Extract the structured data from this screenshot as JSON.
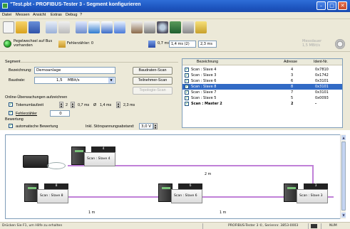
{
  "window": {
    "title": "\"Test.pbt - PROFIBUS-Tester 3 - Segment konfigurieren"
  },
  "menu": [
    "Datei",
    "Messen",
    "Ansicht",
    "Extras",
    "Debug",
    "?"
  ],
  "status": {
    "bus_status_line1": "Pegelwechsel auf Bus",
    "bus_status_line2": "vorhanden",
    "error_counter": "Fehlerzähler: 0",
    "time_1": "0,7 ms",
    "time_2": "1,4 ms (2)",
    "time_3": "2,3 ms",
    "right_info_1": "Messdauer",
    "right_info_2": "1,5 MBit/s"
  },
  "segment": {
    "group_label": "Segment",
    "name_label": "Bezeichnung:",
    "name_value": "Demoanlage",
    "baud_label": "Baudrate:",
    "baud_value": "1,5",
    "baud_unit": "MBit/s",
    "btn_baud_scan": "Baudraten-Scan",
    "btn_participant_scan": "Teilnehmer-Scan",
    "btn_topology_scan": "Topologie-Scan"
  },
  "monitoring": {
    "group_label": "Online-Überwachungen aufzeichnen",
    "token_label": "Tokenumlaufzeit",
    "token_count": "2",
    "token_min": "0,7 ms",
    "token_avg_prefix": "Ø",
    "token_avg": "1,4 ms",
    "token_max": "2,3 ms",
    "error_counter_label": "Fehlerzähler",
    "error_counter_value": "0"
  },
  "evaluation": {
    "group_label": "Bewertung",
    "auto_label": "automatische Bewertung",
    "noise_label": "Inkl. Störspannungsabstand:",
    "noise_value": "3,0 V"
  },
  "table": {
    "headers": [
      "Bezeichnung",
      "Adresse",
      "Ident-Nr."
    ],
    "rows": [
      {
        "name": "Scan : Slave 4",
        "address": "4",
        "ident": "0x7810"
      },
      {
        "name": "Scan : Slave 3",
        "address": "3",
        "ident": "0x1742"
      },
      {
        "name": "Scan : Slave 6",
        "address": "6",
        "ident": "0x3101"
      },
      {
        "name": "Scan : Slave 8",
        "address": "8",
        "ident": "0x3101"
      },
      {
        "name": "Scan : Slave 7",
        "address": "7",
        "ident": "0x3101"
      },
      {
        "name": "Scan : Slave 5",
        "address": "5",
        "ident": "0x0093"
      },
      {
        "name": "Scan : Master 2",
        "address": "2",
        "ident": "-"
      }
    ]
  },
  "diagram": {
    "slaves": [
      {
        "tag": "4",
        "name": "Scan : Slave 4"
      },
      {
        "tag": "8",
        "name": "Scan : Slave 8"
      },
      {
        "tag": "6",
        "name": "Scan : Slave 6"
      },
      {
        "tag": "3",
        "name": "Scan : Slave 3"
      }
    ],
    "segments": [
      "2 m",
      "1 m",
      "1 m"
    ]
  },
  "statusbar": {
    "help": "Drücken Sie F1, um Hilfe zu erhalten",
    "product": "PROFIBUS-Tester 3 ©, Seriennr. 3853-0003",
    "mode": "NUM"
  },
  "colors": {
    "cable": "#c080d8",
    "selection": "#316ac5",
    "title_bar": "#2e6ed8"
  }
}
